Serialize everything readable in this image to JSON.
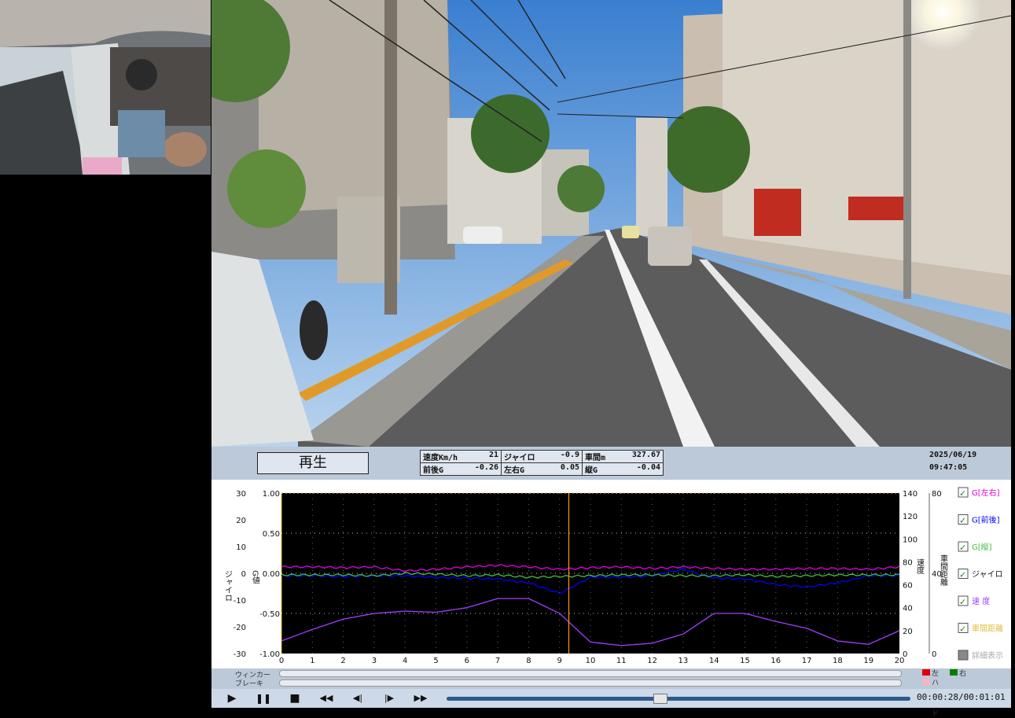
{
  "player": {
    "play_label": "再生",
    "date": "2025/06/19",
    "clock": "09:47:05",
    "time_display": "00:00:28/00:01:01",
    "progress": 0.46
  },
  "sensors": [
    [
      {
        "label": "速度Km/h",
        "value": "21"
      },
      {
        "label": "ジャイロ",
        "value": "-0.9"
      },
      {
        "label": "車間m",
        "value": "327.67"
      }
    ],
    [
      {
        "label": "前後G",
        "value": "-0.26"
      },
      {
        "label": "左右G",
        "value": "0.05"
      },
      {
        "label": "縦G",
        "value": "-0.04"
      }
    ]
  ],
  "signals": {
    "winker_label": "ウィンカー",
    "brake_label": "ブレーキ",
    "legend": [
      {
        "label": "左",
        "color": "#e00000"
      },
      {
        "label": "右",
        "color": "#008000"
      },
      {
        "label": "ハザード",
        "color": "#f4b6c2"
      }
    ]
  },
  "controls": [
    {
      "name": "play-button",
      "glyph": "▶"
    },
    {
      "name": "pause-button",
      "glyph": "❚❚"
    },
    {
      "name": "stop-button",
      "glyph": "■"
    },
    {
      "name": "rewind-button",
      "glyph": "◀◀"
    },
    {
      "name": "step-back-button",
      "glyph": "◀|"
    },
    {
      "name": "step-forward-button",
      "glyph": "|▶"
    },
    {
      "name": "fast-forward-button",
      "glyph": "▶▶"
    }
  ],
  "legend": [
    {
      "label": "G[左右]",
      "color": "#e000e0",
      "checked": true
    },
    {
      "label": "G[前後]",
      "color": "#0000ff",
      "checked": true
    },
    {
      "label": "G[縦]",
      "color": "#40c040",
      "checked": true
    },
    {
      "label": "ジャイロ",
      "color": "#ffffff",
      "checked": true
    },
    {
      "label": "速 度",
      "color": "#a040ff",
      "checked": true
    },
    {
      "label": "車間距離",
      "color": "#e0c040",
      "checked": true
    },
    {
      "label": "詳細表示",
      "color": "#aaaaaa",
      "checked": false
    }
  ],
  "chart_data": {
    "type": "line",
    "x": [
      0,
      1,
      2,
      3,
      4,
      5,
      6,
      7,
      8,
      9,
      10,
      11,
      12,
      13,
      14,
      15,
      16,
      17,
      18,
      19,
      20
    ],
    "xlim": [
      0,
      20
    ],
    "xticks": [
      "0",
      "1",
      "2",
      "3",
      "4",
      "5",
      "6",
      "7",
      "8",
      "9",
      "10",
      "11",
      "12",
      "13",
      "14",
      "15",
      "16",
      "17",
      "18",
      "19",
      "20"
    ],
    "gyro_axis": {
      "label": "ジャイロ",
      "ticks": [
        "30",
        "20",
        "10",
        "0",
        "-10",
        "-20",
        "-30"
      ],
      "ylim": [
        -30,
        30
      ]
    },
    "g_axis": {
      "label": "G値",
      "ticks": [
        "1.00",
        "0.50",
        "0.00",
        "-0.50",
        "-1.00"
      ],
      "ylim": [
        -1,
        1
      ]
    },
    "speed_axis": {
      "label": "速度",
      "ticks": [
        "140",
        "120",
        "100",
        "80",
        "60",
        "40",
        "20",
        "0"
      ],
      "ylim": [
        0,
        140
      ]
    },
    "distance_axis": {
      "label": "車間距離",
      "ticks": [
        "80",
        "40",
        "0"
      ],
      "ylim": [
        0,
        80
      ]
    },
    "cursor_x": 9.3,
    "series": [
      {
        "name": "G[左右]",
        "color": "#e000e0",
        "values": [
          0.08,
          0.08,
          0.07,
          0.08,
          0.03,
          0.05,
          0.08,
          0.1,
          0.08,
          0.05,
          0.07,
          0.08,
          0.06,
          0.08,
          0.06,
          0.05,
          0.05,
          0.06,
          0.06,
          0.05,
          0.08
        ]
      },
      {
        "name": "G[前後]",
        "color": "#0000ff",
        "values": [
          -0.03,
          -0.03,
          -0.04,
          -0.03,
          -0.03,
          -0.05,
          -0.06,
          -0.07,
          -0.12,
          -0.25,
          -0.05,
          -0.05,
          -0.03,
          0.05,
          -0.06,
          -0.07,
          -0.14,
          -0.17,
          -0.12,
          -0.03,
          -0.03
        ]
      },
      {
        "name": "G[縦]",
        "color": "#40c040",
        "values": [
          -0.02,
          -0.02,
          -0.02,
          -0.03,
          0.0,
          -0.01,
          -0.03,
          -0.02,
          -0.05,
          -0.04,
          -0.03,
          -0.02,
          -0.02,
          -0.03,
          -0.03,
          -0.02,
          -0.04,
          -0.03,
          -0.02,
          -0.02,
          -0.02
        ]
      },
      {
        "name": "速度",
        "color": "#a040ff",
        "values": [
          11,
          21,
          30,
          35,
          37,
          36,
          40,
          48,
          48,
          35,
          10,
          7,
          9,
          17,
          35,
          35,
          28,
          22,
          11,
          8,
          20
        ]
      }
    ]
  }
}
